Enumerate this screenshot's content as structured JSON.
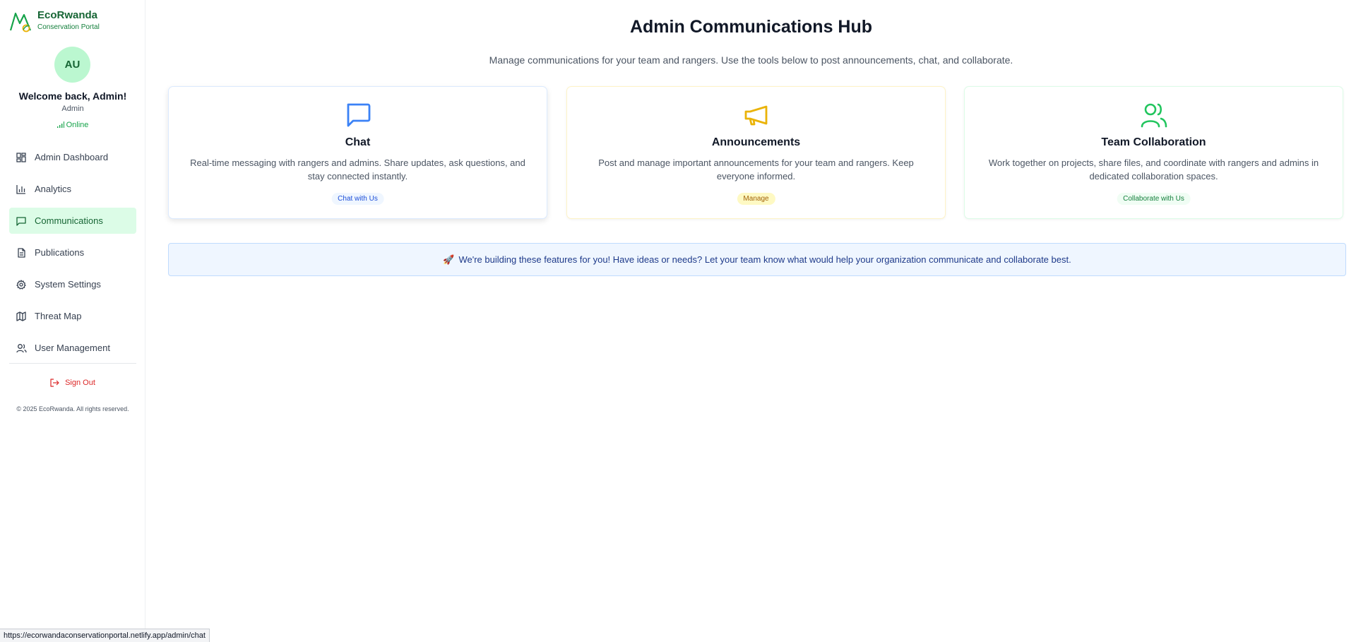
{
  "brand": {
    "name": "EcoRwanda",
    "subtitle": "Conservation Portal",
    "accent": "#16a34a"
  },
  "user": {
    "initials": "AU",
    "welcome": "Welcome back, Admin!",
    "role": "Admin",
    "status": "Online"
  },
  "sidebar": {
    "items": [
      {
        "label": "Admin Dashboard",
        "icon": "dashboard-grid-icon",
        "active": false
      },
      {
        "label": "Analytics",
        "icon": "bar-chart-icon",
        "active": false
      },
      {
        "label": "Communications",
        "icon": "message-square-icon",
        "active": true
      },
      {
        "label": "Publications",
        "icon": "document-icon",
        "active": false
      },
      {
        "label": "System Settings",
        "icon": "gear-icon",
        "active": false
      },
      {
        "label": "Threat Map",
        "icon": "map-icon",
        "active": false
      },
      {
        "label": "User Management",
        "icon": "users-icon",
        "active": false
      }
    ],
    "sign_out": "Sign Out",
    "copyright": "© 2025 EcoRwanda. All rights reserved."
  },
  "main": {
    "title": "Admin Communications Hub",
    "subtitle": "Manage communications for your team and rangers. Use the tools below to post announcements, chat, and collaborate.",
    "cards": [
      {
        "title": "Chat",
        "description": "Real-time messaging with rangers and admins. Share updates, ask questions, and stay connected instantly.",
        "tag": "Chat with Us",
        "icon": "message-square-icon",
        "color": "#3b82f6"
      },
      {
        "title": "Announcements",
        "description": "Post and manage important announcements for your team and rangers. Keep everyone informed.",
        "tag": "Manage",
        "icon": "megaphone-icon",
        "color": "#eab308"
      },
      {
        "title": "Team Collaboration",
        "description": "Work together on projects, share files, and coordinate with rangers and admins in dedicated collaboration spaces.",
        "tag": "Collaborate with Us",
        "icon": "users-icon",
        "color": "#22c55e"
      }
    ],
    "banner": {
      "icon": "rocket-icon",
      "text": "We're building these features for you! Have ideas or needs? Let your team know what would help your organization communicate and collaborate best."
    }
  },
  "status_url": "https://ecorwandaconservationportal.netlify.app/admin/chat"
}
